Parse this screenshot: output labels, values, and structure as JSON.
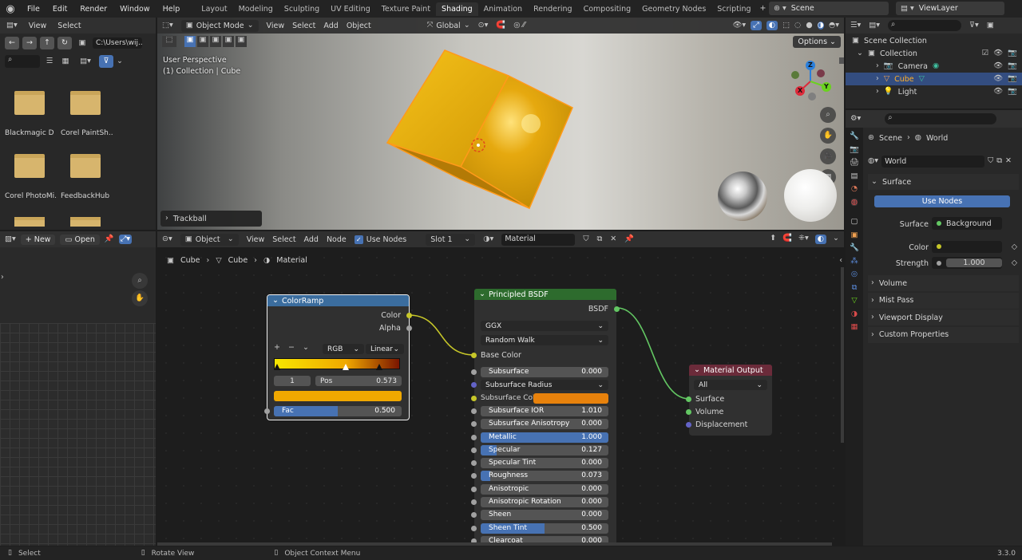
{
  "topbar": {
    "menus": [
      "File",
      "Edit",
      "Render",
      "Window",
      "Help"
    ],
    "tabs": [
      "Layout",
      "Modeling",
      "Sculpting",
      "UV Editing",
      "Texture Paint",
      "Shading",
      "Animation",
      "Rendering",
      "Compositing",
      "Geometry Nodes",
      "Scripting"
    ],
    "active_tab": "Shading",
    "scene": "Scene",
    "view_layer": "ViewLayer"
  },
  "filebrowser": {
    "menus": [
      "View",
      "Select"
    ],
    "path": "C:\\Users\\wij...",
    "items": [
      "Blackmagic D",
      "Corel PaintSh...",
      "Corel PhotoMi...",
      "FeedbackHub"
    ]
  },
  "viewport": {
    "mode": "Object Mode",
    "menus": [
      "View",
      "Select",
      "Add",
      "Object"
    ],
    "orientation": "Global",
    "options": "Options",
    "perspective": "User Perspective",
    "collection_info": "(1) Collection | Cube",
    "last_op": "Trackball",
    "axis_x": "X",
    "axis_y": "Y",
    "axis_z": "Z"
  },
  "outliner": {
    "root": "Scene Collection",
    "collection": "Collection",
    "items": [
      {
        "name": "Camera"
      },
      {
        "name": "Cube"
      },
      {
        "name": "Light"
      }
    ]
  },
  "properties": {
    "crumb_scene": "Scene",
    "crumb_world": "World",
    "world_name": "World",
    "surface_panel": "Surface",
    "use_nodes": "Use Nodes",
    "surface_label": "Surface",
    "surface_value": "Background",
    "color_label": "Color",
    "strength_label": "Strength",
    "strength_value": "1.000",
    "panels": [
      "Volume",
      "Mist Pass",
      "Viewport Display",
      "Custom Properties"
    ]
  },
  "image_editor": {
    "new": "New",
    "open": "Open"
  },
  "node_editor": {
    "object": "Object",
    "menus": [
      "View",
      "Select",
      "Add",
      "Node"
    ],
    "use_nodes": "Use Nodes",
    "slot": "Slot 1",
    "material": "Material",
    "crumbs": [
      "Cube",
      "Cube",
      "Material"
    ]
  },
  "colorramp": {
    "title": "ColorRamp",
    "out_color": "Color",
    "out_alpha": "Alpha",
    "mode": "RGB",
    "interp": "Linear",
    "index": "1",
    "pos_label": "Pos",
    "pos_value": "0.573",
    "fac_label": "Fac",
    "fac_value": "0.500",
    "fac_fill": 0.5,
    "stop_colors": [
      "#f7e600",
      "#f0a800",
      "#7a1500"
    ]
  },
  "bsdf": {
    "title": "Principled BSDF",
    "output": "BSDF",
    "distribution": "GGX",
    "sss_method": "Random Walk",
    "base_color": "Base Color",
    "fields": [
      {
        "label": "Subsurface",
        "value": "0.000",
        "fill": 0
      },
      {
        "label": "Subsurface IOR",
        "value": "1.010",
        "fill": 0
      },
      {
        "label": "Subsurface Anisotropy",
        "value": "0.000",
        "fill": 0
      },
      {
        "label": "Metallic",
        "value": "1.000",
        "fill": 1
      },
      {
        "label": "Specular",
        "value": "0.127",
        "fill": 0.127
      },
      {
        "label": "Specular Tint",
        "value": "0.000",
        "fill": 0
      },
      {
        "label": "Roughness",
        "value": "0.073",
        "fill": 0.073
      },
      {
        "label": "Anisotropic",
        "value": "0.000",
        "fill": 0
      },
      {
        "label": "Anisotropic Rotation",
        "value": "0.000",
        "fill": 0
      },
      {
        "label": "Sheen",
        "value": "0.000",
        "fill": 0
      },
      {
        "label": "Sheen Tint",
        "value": "0.500",
        "fill": 0.5
      },
      {
        "label": "Clearcoat",
        "value": "0.000",
        "fill": 0
      }
    ],
    "subsurface_radius": "Subsurface Radius",
    "subsurface_color": "Subsurface Col...",
    "subsurface_color_hex": "#e8820c"
  },
  "output": {
    "title": "Material Output",
    "target": "All",
    "inputs": [
      "Surface",
      "Volume",
      "Displacement"
    ]
  },
  "status": {
    "select": "Select",
    "rotate": "Rotate View",
    "context": "Object Context Menu",
    "version": "3.3.0"
  },
  "colors": {
    "accent": "#4772b3",
    "header": "#303030",
    "node_color": "#3b6d9e",
    "node_shader": "#2d6b2d",
    "node_output": "#6b2b3a"
  }
}
